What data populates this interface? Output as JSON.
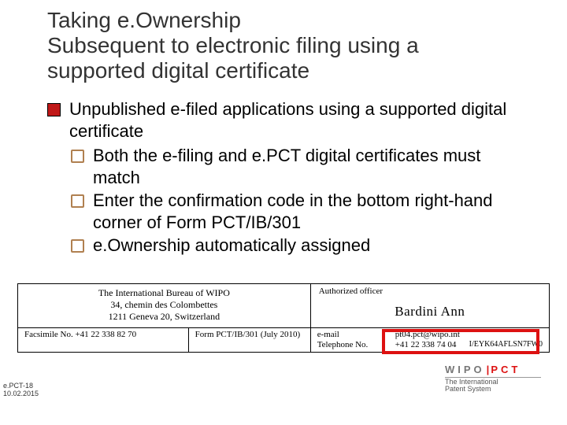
{
  "title": "Taking e.Ownership\nSubsequent to electronic filing using a supported digital certificate",
  "bullet": "Unpublished e-filed applications using a supported digital certificate",
  "subs": [
    "Both the e-filing and e.PCT digital certificates must match",
    "Enter the confirmation code in the bottom right-hand corner of Form PCT/IB/301",
    "e.Ownership automatically assigned"
  ],
  "form": {
    "bureau_l1": "The International Bureau of WIPO",
    "bureau_l2": "34, chemin des Colombettes",
    "bureau_l3": "1211 Geneva 20, Switzerland",
    "auth_label": "Authorized officer",
    "officer": "Bardini Ann",
    "fax_label": "Facsimile No. +41 22 338 82 70",
    "form_id": "Form PCT/IB/301 (July 2010)",
    "email_label": "e-mail",
    "email_value": "pt04.pct@wipo.int",
    "tel_label": "Telephone No.",
    "tel_value": "+41 22 338 74 04",
    "code": "I/EYK64AFLSN7FW0"
  },
  "brand": {
    "wipo": "WIPO",
    "pct": "PCT",
    "sub1": "The International",
    "sub2": "Patent System"
  },
  "footer": {
    "ref": "e.PCT-18",
    "date": "10.02.2015"
  }
}
